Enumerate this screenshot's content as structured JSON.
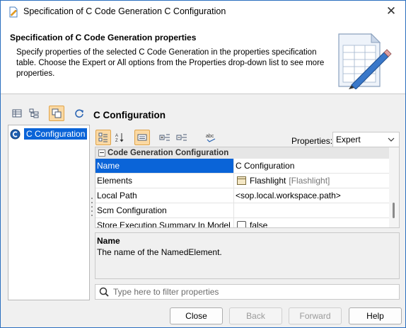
{
  "window": {
    "title": "Specification of C Code Generation C Configuration",
    "close_glyph": "✕"
  },
  "header": {
    "title": "Specification of C Code Generation properties",
    "description": "Specify properties of the selected C Code Generation in the properties specification table. Choose the Expert or All options from the Properties drop-down list to see more properties."
  },
  "spec_title": "C Configuration",
  "tree": {
    "items": [
      {
        "label": "C Configuration",
        "icon": "c-config-icon"
      }
    ]
  },
  "properties": {
    "label": "Properties:",
    "selected": "Expert"
  },
  "grid": {
    "group": "Code Generation Configuration",
    "rows": [
      {
        "key": "Name",
        "value": "C Configuration",
        "selected": true
      },
      {
        "key": "Elements",
        "value": "Flashlight",
        "extra": "[Flashlight]",
        "icon": "block-icon"
      },
      {
        "key": "Local Path",
        "value": "<sop.local.workspace.path>"
      },
      {
        "key": "Scm Configuration",
        "value": ""
      },
      {
        "key": "Store Execution Summary In Model",
        "value": "false",
        "checkbox": false
      }
    ]
  },
  "description": {
    "term": "Name",
    "text": "The name of the NamedElement."
  },
  "filter": {
    "placeholder": "Type here to filter properties",
    "value": ""
  },
  "buttons": {
    "close": "Close",
    "back": "Back",
    "forward": "Forward",
    "help": "Help"
  },
  "colors": {
    "selection": "#0a64d8",
    "active_toggle": "#fbd9a3",
    "window_border": "#2b6fbf"
  }
}
